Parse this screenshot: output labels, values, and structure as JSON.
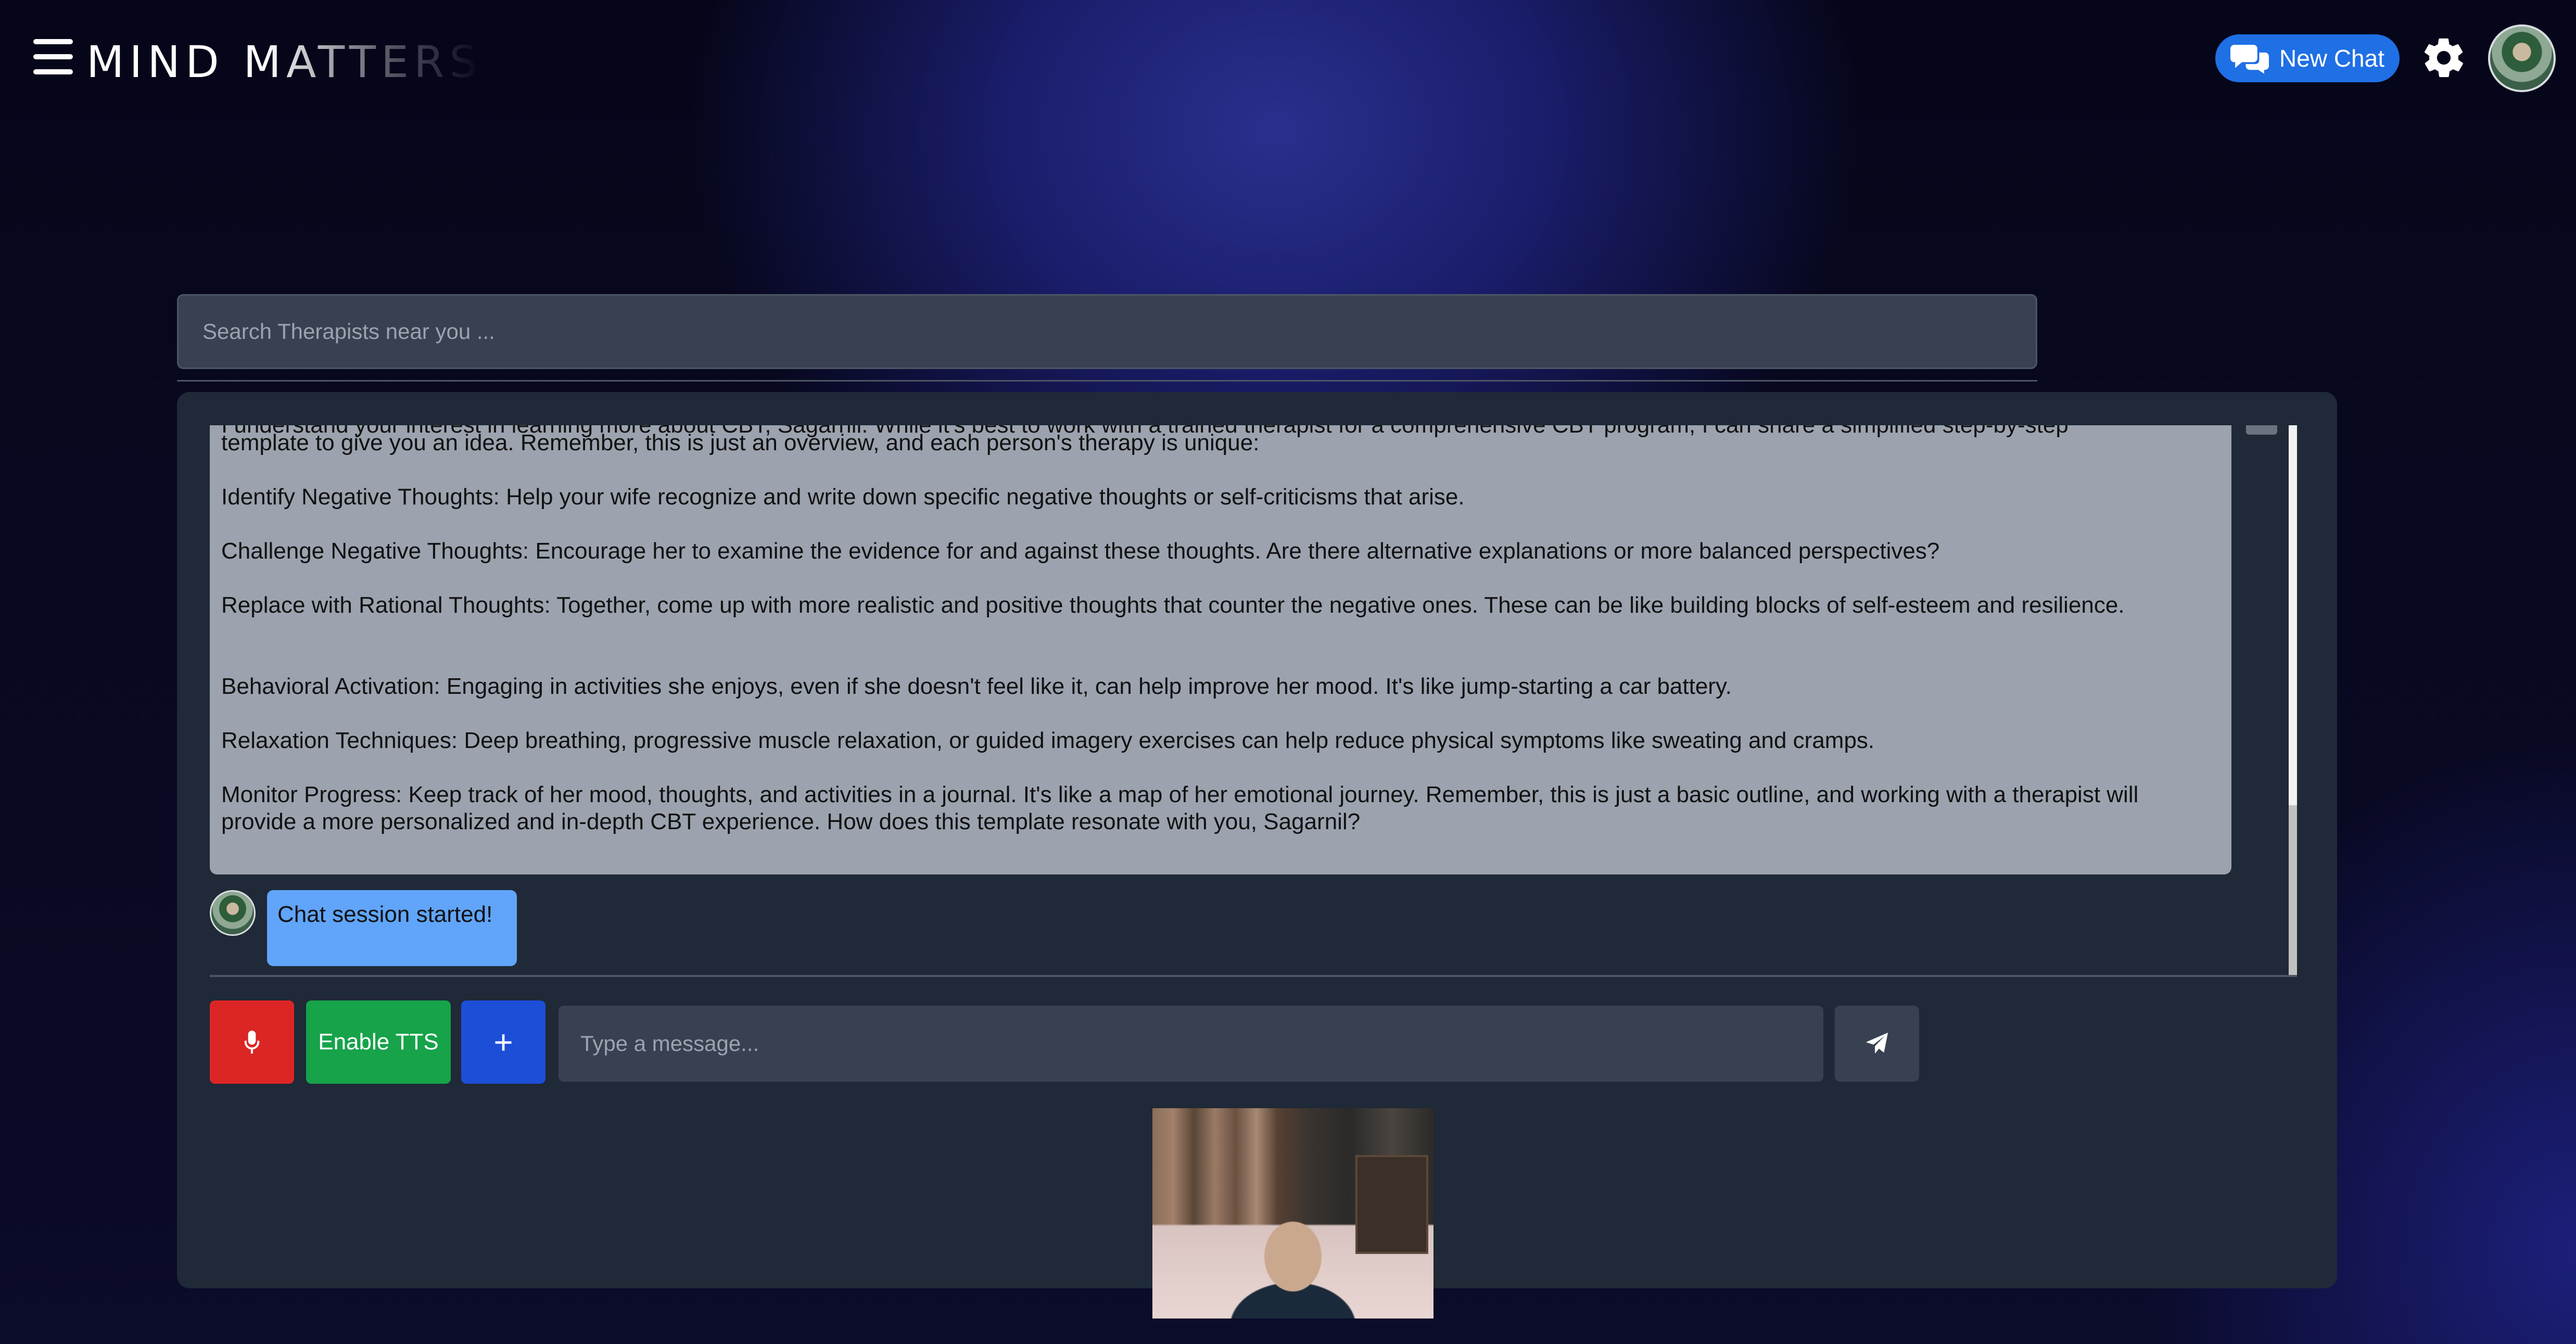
{
  "header": {
    "brand": "MIND MATTERS",
    "new_chat_label": "New Chat"
  },
  "search": {
    "placeholder": "Search Therapists near you ..."
  },
  "chat": {
    "bot_message": {
      "cut_top_line": "I understand your interest in learning more about CBT, Sagarnil. While it's best to work with a trained therapist for a comprehensive CBT program, I can share a simplified step-by-step",
      "paragraphs": [
        "template to give you an idea. Remember, this is just an overview, and each person's therapy is unique:",
        "Identify Negative Thoughts: Help your wife recognize and write down specific negative thoughts or self-criticisms that arise.",
        "Challenge Negative Thoughts: Encourage her to examine the evidence for and against these thoughts. Are there alternative explanations or more balanced perspectives?",
        "Replace with Rational Thoughts: Together, come up with more realistic and positive thoughts that counter the negative ones. These can be like building blocks of self-esteem and resilience.",
        "Behavioral Activation: Engaging in activities she enjoys, even if she doesn't feel like it, can help improve her mood. It's like jump-starting a car battery.",
        "Relaxation Techniques: Deep breathing, progressive muscle relaxation, or guided imagery exercises can help reduce physical symptoms like sweating and cramps.",
        "Monitor Progress: Keep track of her mood, thoughts, and activities in a journal. It's like a map of her emotional journey. Remember, this is just a basic outline, and working with a therapist will provide a more personalized and in-depth CBT experience. How does this template resonate with you, Sagarnil?"
      ]
    },
    "user_message": "Chat session started!"
  },
  "controls": {
    "tts_label": "Enable TTS",
    "plus_label": "+",
    "message_placeholder": "Type a message..."
  },
  "icons": {
    "menu": "hamburger-icon",
    "new_chat": "chat-bubbles-icon",
    "settings": "gear-icon",
    "mic": "microphone-icon",
    "send": "paper-plane-icon"
  },
  "colors": {
    "new_chat_button": "#1f6fe5",
    "mic_button": "#dc2626",
    "tts_button": "#16a34a",
    "plus_button": "#1d4ed8",
    "bot_bubble": "#9ca3af",
    "user_bubble": "#60a5fa",
    "panel": "#1f2937"
  }
}
